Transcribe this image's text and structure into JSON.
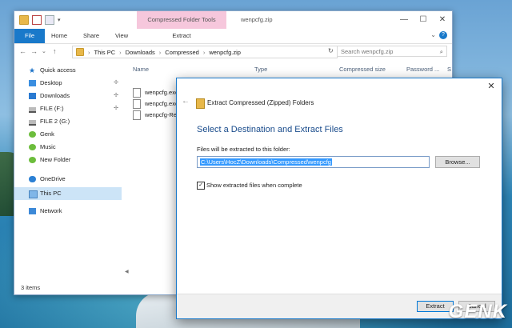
{
  "window": {
    "context_tab": "Compressed Folder Tools",
    "title": "wenpcfg.zip",
    "minimize": "—",
    "maximize": "☐",
    "close": "✕"
  },
  "ribbon": {
    "tabs": [
      "File",
      "Home",
      "Share",
      "View",
      "Extract"
    ],
    "collapse": "⌄",
    "help": "?"
  },
  "address": {
    "back": "←",
    "forward": "→",
    "recent": "⌄",
    "up": "↑",
    "crumbs": [
      "This PC",
      "Downloads",
      "Compressed",
      "wenpcfg.zip"
    ],
    "separator": "›",
    "refresh": "↻",
    "search_placeholder": "Search wenpcfg.zip",
    "search_icon": "⌕"
  },
  "nav": {
    "items": [
      {
        "label": "Quick access",
        "icon": "star-icon",
        "pinned": false
      },
      {
        "label": "Desktop",
        "icon": "desktop-icon",
        "pinned": true
      },
      {
        "label": "Downloads",
        "icon": "downloads-icon",
        "pinned": true
      },
      {
        "label": "FILE (F:)",
        "icon": "drive-icon",
        "pinned": true
      },
      {
        "label": "FILE 2 (G:)",
        "icon": "drive-icon",
        "pinned": false
      },
      {
        "label": "Genk",
        "icon": "folder-icon",
        "pinned": false
      },
      {
        "label": "Music",
        "icon": "folder-icon",
        "pinned": false
      },
      {
        "label": "New Folder",
        "icon": "folder-icon",
        "pinned": false
      },
      {
        "label": "OneDrive",
        "icon": "onedrive-icon",
        "pinned": false
      },
      {
        "label": "This PC",
        "icon": "pc-icon",
        "pinned": false
      },
      {
        "label": "Network",
        "icon": "network-icon",
        "pinned": false
      }
    ],
    "pin_glyph": "📌"
  },
  "files": {
    "columns": [
      "Name",
      "Type",
      "Compressed size",
      "Password ...",
      "S"
    ],
    "rows": [
      "wenpcfg.exe",
      "wenpcfg.exe",
      "wenpcfg-Re"
    ]
  },
  "status": "3 items",
  "dialog": {
    "close": "✕",
    "back": "←",
    "title": "Extract Compressed (Zipped) Folders",
    "heading": "Select a Destination and Extract Files",
    "path_label": "Files will be extracted to this folder:",
    "path_value": "C:\\Users\\HocZ\\Downloads\\Compressed\\wenpcfg",
    "browse": "Browse...",
    "show_files_label": "Show extracted files when complete",
    "show_files_checked": "✓",
    "extract": "Extract",
    "cancel": "Cancel"
  },
  "watermark": "GENK"
}
